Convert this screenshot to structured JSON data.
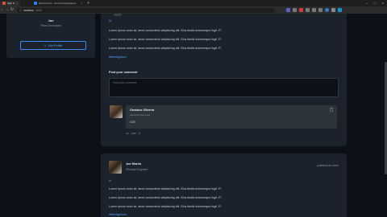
{
  "browser": {
    "tabs": [
      {
        "label": "Sign in",
        "active": true,
        "color": "#e04f3a"
      },
      {
        "label": "DevConnect - Connect Developers",
        "active": false,
        "color": "#2f81f7"
      }
    ],
    "url_host": "localhost",
    "url_port": ":3000"
  },
  "profile": {
    "name": "Joe",
    "role": "Fiber Developer",
    "edit_label": "Edit Profile"
  },
  "post1": {
    "tag": "hi",
    "lines": [
      "Lorem ipsum dolor sit, amet consectetur adipisicing elit. Eius facilis doloremque fugit. Fl",
      "Lorem ipsum dolor sit, amet consectetur adipisicing elit. Eius facilis doloremque fugit. Fl",
      "Lorem ipsum dolor sit, amet consectetur adipisicing elit. Eius facilis doloremque fugit. Fl"
    ],
    "hashtag": "#fiber#golium",
    "comment_title": "Post your comment",
    "comment_placeholder": "Post your comment",
    "comment": {
      "author": "Gustavo Oliveira",
      "time": "seconds hours ago",
      "text": "GO!!",
      "like_label": "Like",
      "like_count": "0"
    }
  },
  "post2": {
    "author": "Joe Morris",
    "role": "Principal Engineer",
    "time": "published an hours",
    "tag": "hi",
    "lines": [
      "Lorem ipsum dolor sit, amet consectetur adipisicing elit. Eius facilis doloremque fugit. Fl",
      "Lorem ipsum dolor sit, amet consectetur adipisicing elit. Eius facilis doloremque fugit. Fl",
      "Lorem ipsum dolor sit, amet consectetur adipisicing elit. Eius facilis doloremque fugit. Fl"
    ],
    "hashtag": "#fiber#golium"
  },
  "icons": {
    "edit": "pencil-icon",
    "trash": "trash-icon",
    "like": "thumbs-up-icon"
  },
  "colors": {
    "background": "#0d1117",
    "card": "#1b222b",
    "accent": "#58a6ff"
  }
}
